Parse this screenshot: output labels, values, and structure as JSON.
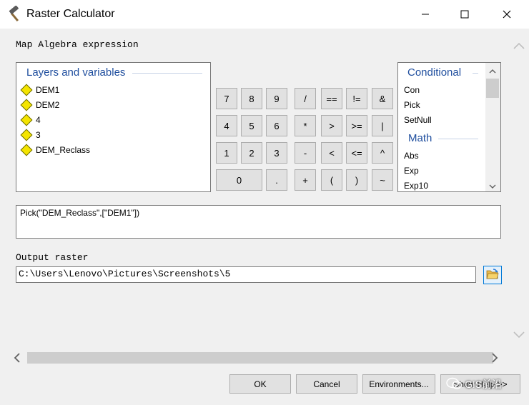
{
  "window": {
    "title": "Raster Calculator"
  },
  "expression_label": "Map Algebra expression",
  "layers": {
    "title": "Layers and variables",
    "items": [
      "DEM1",
      "DEM2",
      "4",
      "3",
      "DEM_Reclass"
    ]
  },
  "keypad": {
    "row1": [
      "7",
      "8",
      "9",
      "/",
      "==",
      "!=",
      "&"
    ],
    "row2": [
      "4",
      "5",
      "6",
      "*",
      ">",
      ">=",
      "|"
    ],
    "row3": [
      "1",
      "2",
      "3",
      "-",
      "<",
      "<=",
      "^"
    ],
    "row4": [
      "0",
      ".",
      "+",
      "(",
      ")",
      "~"
    ]
  },
  "functions": {
    "group1_title": "Conditional",
    "group1_items": [
      "Con",
      "Pick",
      "SetNull"
    ],
    "group2_title": "Math",
    "group2_items": [
      "Abs",
      "Exp",
      "Exp10"
    ]
  },
  "expression_value": "Pick(\"DEM_Reclass\",[\"DEM1\"])",
  "output": {
    "label": "Output raster",
    "value": "C:\\Users\\Lenovo\\Pictures\\Screenshots\\5"
  },
  "buttons": {
    "ok": "OK",
    "cancel": "Cancel",
    "environments": "Environments...",
    "show_help": "Show Help >>"
  },
  "watermark": "GIS前沿",
  "icons": {
    "app": "hammer-icon",
    "minimize": "minimize-icon",
    "maximize": "maximize-icon",
    "close": "close-icon",
    "browse": "folder-open-icon",
    "diamond": "layer-diamond-icon"
  },
  "colors": {
    "group_title": "#1f4e9e",
    "focus_border": "#0078d7",
    "layer_diamond": "#f4e400"
  }
}
